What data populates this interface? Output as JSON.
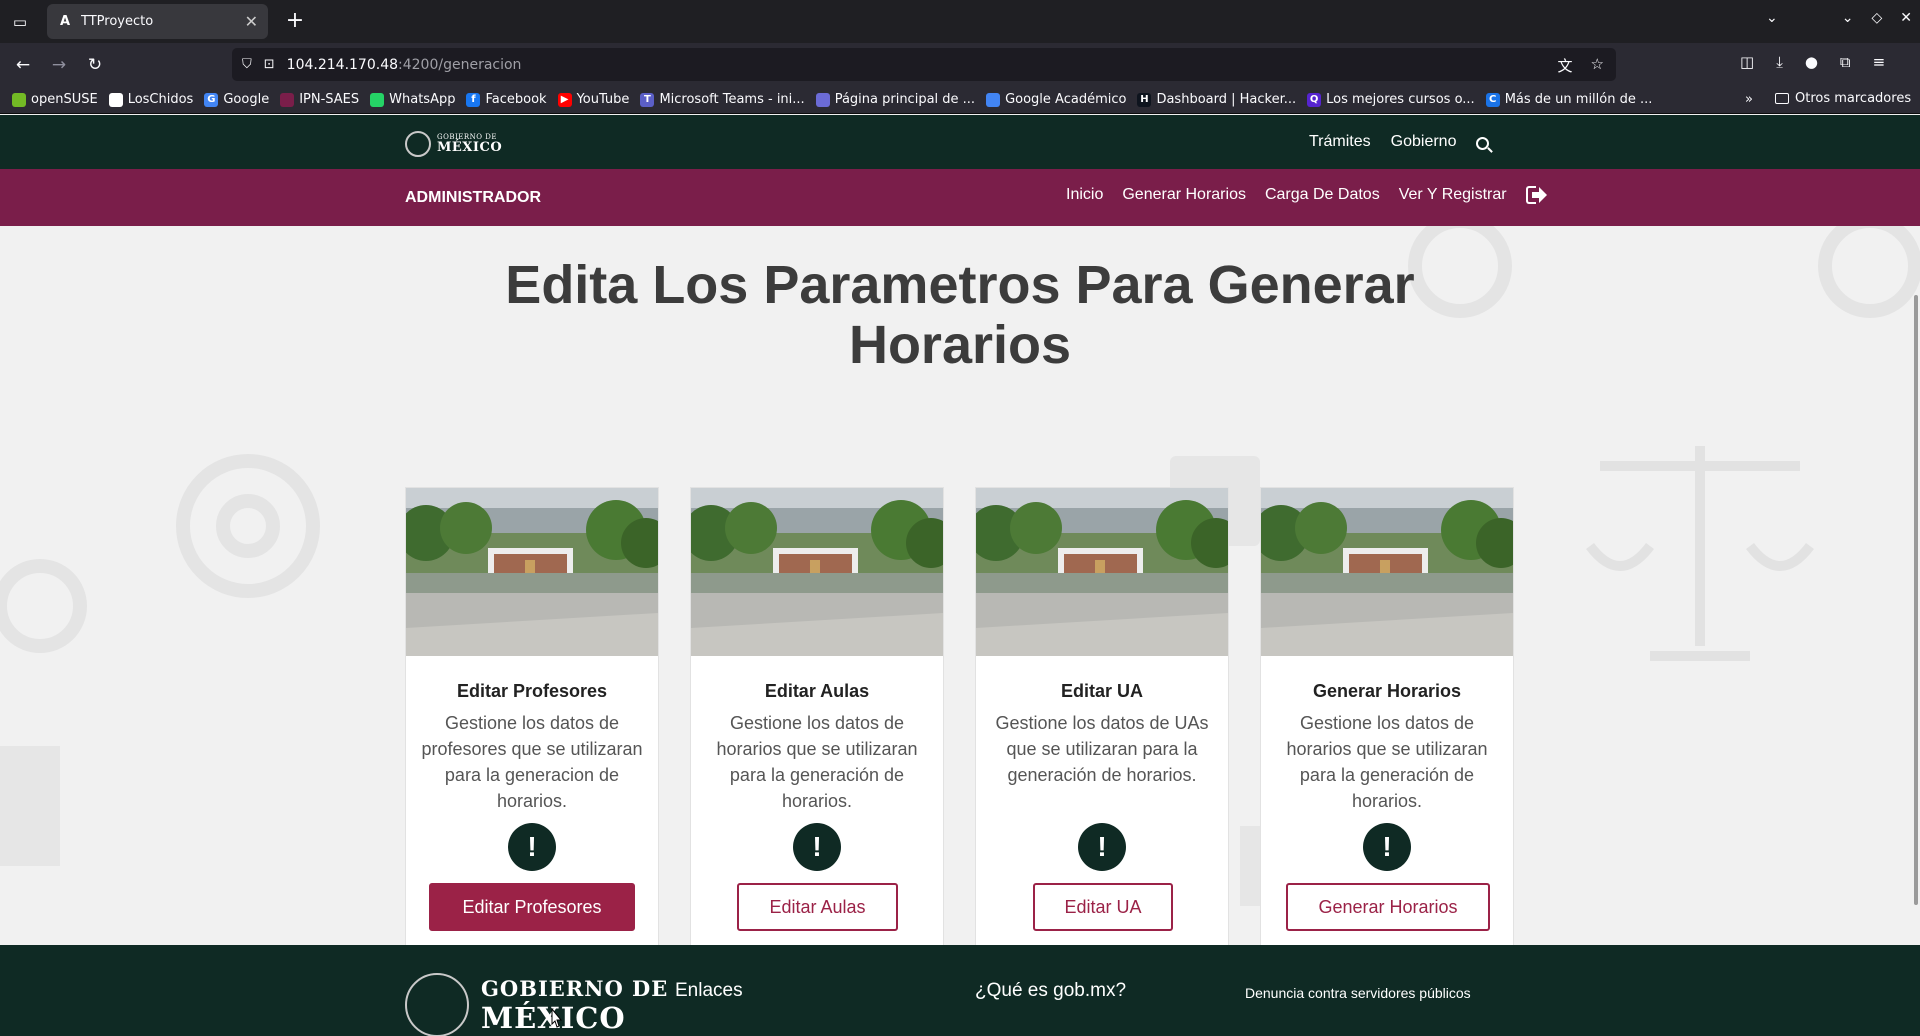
{
  "browser": {
    "tab_title": "TTProyecto",
    "tab_favicon": "A",
    "url_host": "104.214.170.48",
    "url_path": ":4200/generacion",
    "bookmarks": [
      {
        "label": "openSUSE",
        "color": "#73ba25",
        "glyph": ""
      },
      {
        "label": "LosChidos",
        "color": "#ffffff",
        "glyph": ""
      },
      {
        "label": "Google",
        "color": "#4285f4",
        "glyph": "G"
      },
      {
        "label": "IPN-SAES",
        "color": "#7a1e4a",
        "glyph": ""
      },
      {
        "label": "WhatsApp",
        "color": "#25d366",
        "glyph": ""
      },
      {
        "label": "Facebook",
        "color": "#1877f2",
        "glyph": "f"
      },
      {
        "label": "YouTube",
        "color": "#ff0000",
        "glyph": "▶"
      },
      {
        "label": "Microsoft Teams - ini...",
        "color": "#5b5fc7",
        "glyph": "T"
      },
      {
        "label": "Página principal de ...",
        "color": "#6b6bd6",
        "glyph": ""
      },
      {
        "label": "Google Académico",
        "color": "#4285f4",
        "glyph": ""
      },
      {
        "label": "Dashboard | Hacker...",
        "color": "#0e141e",
        "glyph": "H"
      },
      {
        "label": "Los mejores cursos o...",
        "color": "#5624d0",
        "glyph": "Q"
      },
      {
        "label": "Más de un millón de ...",
        "color": "#1a73e8",
        "glyph": "C"
      }
    ],
    "other_bookmarks": "Otros marcadores"
  },
  "gob_header": {
    "logo_line1": "GOBIERNO DE",
    "logo_line2": "MÉXICO",
    "nav": [
      "Trámites",
      "Gobierno"
    ]
  },
  "admin_bar": {
    "title": "ADMINISTRADOR",
    "nav": [
      "Inicio",
      "Generar Horarios",
      "Carga De Datos",
      "Ver Y Registrar"
    ]
  },
  "main": {
    "title": "Edita Los Parametros Para Generar Horarios"
  },
  "cards": [
    {
      "title": "Editar Profesores",
      "desc": "Gestione los datos de profesores que se utilizaran para la generacion de horarios.",
      "button": "Editar Profesores"
    },
    {
      "title": "Editar Aulas",
      "desc": "Gestione los datos de horarios que se utilizaran para la generación de horarios.",
      "button": "Editar Aulas"
    },
    {
      "title": "Editar UA",
      "desc": "Gestione los datos de UAs que se utilizaran para la generación de horarios.",
      "button": "Editar UA"
    },
    {
      "title": "Generar Horarios",
      "desc": "Gestione los datos de horarios que se utilizaran para la generación de horarios.",
      "button": "Generar Horarios"
    }
  ],
  "footer": {
    "logo_line1": "GOBIERNO DE",
    "logo_line2": "MÉXICO",
    "col1": "Enlaces",
    "col2": "¿Qué es gob.mx?",
    "col3": "Denuncia contra servidores públicos"
  },
  "colors": {
    "gob_green": "#0f2a24",
    "admin_bar": "#7a1e4a",
    "button_accent": "#9b2247"
  }
}
